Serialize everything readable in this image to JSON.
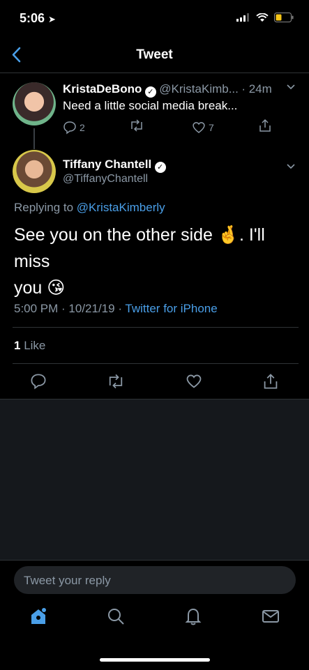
{
  "status": {
    "time": "5:06",
    "battery_color": "#f5c518"
  },
  "nav": {
    "title": "Tweet",
    "back_icon": "chevron-left-icon"
  },
  "parent_tweet": {
    "name": "KristaDeBono",
    "handle": "@KristaKimb...",
    "time": "· 24m",
    "text": "Need a little social media break...",
    "replies": "2",
    "likes": "7"
  },
  "main_tweet": {
    "name": "Tiffany Chantell",
    "handle": "@TiffanyChantell",
    "replying_prefix": "Replying to",
    "replying_to": "@KristaKimberly",
    "text_line1": "See you on the other side",
    "text_after_emoji": ". I'll miss",
    "text_line2": "you",
    "timestamp": "5:00 PM · 10/21/19 · ",
    "source": "Twitter for iPhone",
    "like_count": "1",
    "like_label": "Like"
  },
  "reply": {
    "placeholder": "Tweet your reply"
  },
  "colors": {
    "accent": "#4a9fe8",
    "muted": "#8b98a5",
    "background": "#000000"
  }
}
